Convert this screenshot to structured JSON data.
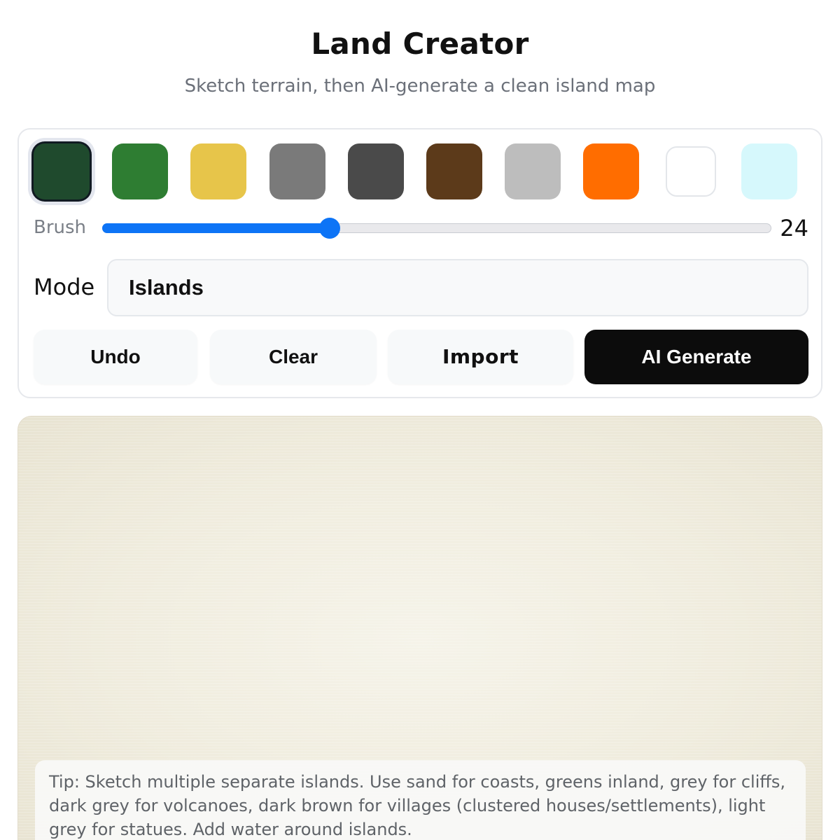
{
  "header": {
    "title": "Land Creator",
    "subtitle": "Sketch terrain, then AI-generate a clean island map"
  },
  "palette": {
    "selected_index": 0,
    "swatches": [
      {
        "name": "dark-green",
        "color": "#1f4a2d"
      },
      {
        "name": "green",
        "color": "#2e7d32"
      },
      {
        "name": "sand",
        "color": "#e7c54a"
      },
      {
        "name": "grey",
        "color": "#7a7a7a"
      },
      {
        "name": "dark-grey",
        "color": "#4a4a4a"
      },
      {
        "name": "dark-brown",
        "color": "#5c3a1a"
      },
      {
        "name": "light-grey",
        "color": "#bdbdbd"
      },
      {
        "name": "orange",
        "color": "#ff6d00"
      },
      {
        "name": "white",
        "color": "#ffffff"
      },
      {
        "name": "light-cyan",
        "color": "#d6f8fc"
      }
    ]
  },
  "brush": {
    "label": "Brush",
    "value": "24",
    "fraction": 0.34
  },
  "mode": {
    "label": "Mode",
    "selected": "Islands"
  },
  "buttons": {
    "undo": "Undo",
    "clear": "Clear",
    "import": "Import",
    "generate": "AI Generate"
  },
  "canvas": {
    "background": "#ede9d9",
    "tip": "Tip: Sketch multiple separate islands. Use sand for coasts, greens inland, grey for cliffs, dark grey for volcanoes, dark brown for villages (clustered houses/settlements), light grey for statues. Add water around islands."
  }
}
